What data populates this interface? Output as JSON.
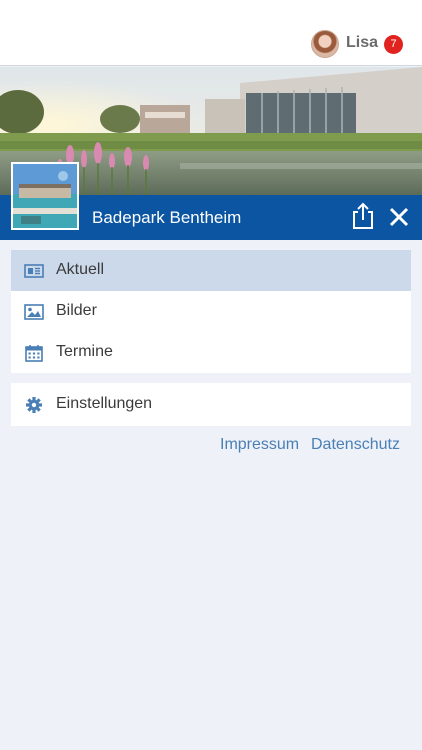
{
  "header": {
    "user_name": "Lisa",
    "notification_count": "7"
  },
  "club": {
    "name": "Badepark Bentheim"
  },
  "menu": {
    "primary": [
      {
        "label": "Aktuell",
        "icon": "newspaper-icon",
        "active": true
      },
      {
        "label": "Bilder",
        "icon": "image-icon",
        "active": false
      },
      {
        "label": "Termine",
        "icon": "calendar-icon",
        "active": false
      }
    ],
    "secondary": [
      {
        "label": "Einstellungen",
        "icon": "gear-icon",
        "active": false
      }
    ]
  },
  "footer_links": {
    "impressum": "Impressum",
    "datenschutz": "Datenschutz"
  },
  "colors": {
    "brand_blue": "#0b55a3",
    "badge_red": "#e1231f",
    "active_row": "#cbd9ea",
    "link_blue": "#4a7fb5",
    "icon_blue": "#4a7fb5",
    "background": "#eef2f8"
  }
}
